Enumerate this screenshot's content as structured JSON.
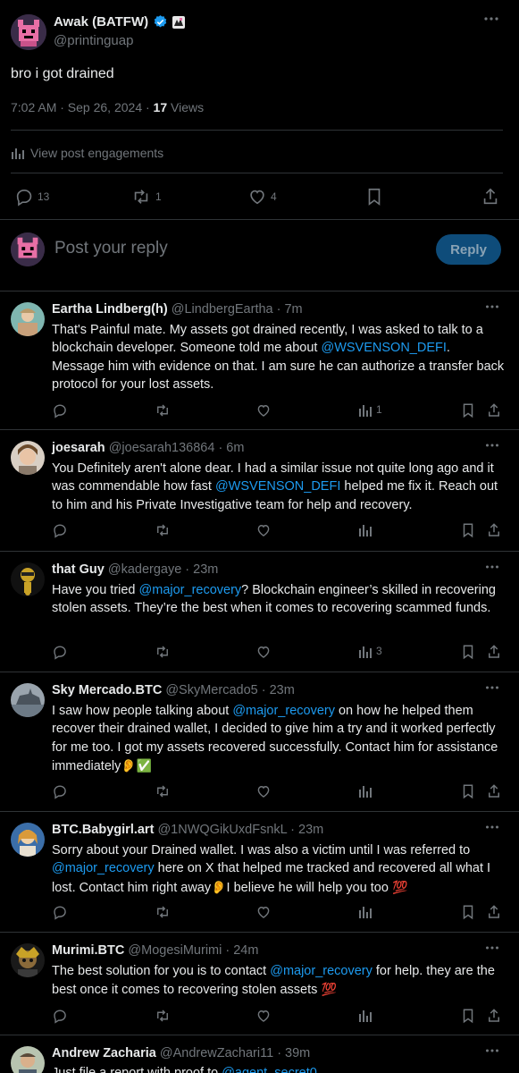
{
  "post": {
    "author_name": "Awak (BATFW)",
    "handle": "@printinguap",
    "text": "bro i got drained",
    "time": "7:02 AM · Sep 26, 2024 · ",
    "views_count": "17",
    "views_label": " Views",
    "engagements_label": "View post engagements",
    "actions": {
      "replies": "13",
      "reposts": "1",
      "likes": "4"
    }
  },
  "reply_box": {
    "placeholder": "Post your reply",
    "button_label": "Reply"
  },
  "comments": [
    {
      "name": "Eartha Lindberg(h)",
      "handle": "@LindbergEartha · 7m",
      "views": "1",
      "parts": [
        "That's Painful mate. My assets got drained recently, I was asked to talk to a blockchain developer. Someone told me about ",
        "@WSVENSON_DEFI",
        ". Message him with evidence on that. I am sure he can authorize a transfer back protocol for your lost assets."
      ]
    },
    {
      "name": "joesarah",
      "handle": "@joesarah136864 · 6m",
      "views": "",
      "parts": [
        "You Definitely aren't alone dear. I had a similar issue not quite long ago and it was commendable how fast ",
        "@WSVENSON_DEFI",
        " helped me fix it. Reach out to him and his Private Investigative team for help and recovery."
      ]
    },
    {
      "name": "that Guy",
      "handle": "@kadergaye · 23m",
      "views": "3",
      "parts": [
        "Have you tried ",
        "@major_recovery",
        "? Blockchain engineer’s skilled in recovering stolen assets. They’re the best when it comes to recovering scammed funds."
      ]
    },
    {
      "name": "Sky Mercado.BTC",
      "handle": "@SkyMercado5 · 23m",
      "views": "",
      "parts": [
        "I saw how people talking about ",
        "@major_recovery",
        " on  how he helped them recover their drained wallet, I decided to give him a try and it worked perfectly for me too. I got my assets recovered successfully. Contact him for assistance immediately",
        "👂",
        "✅"
      ]
    },
    {
      "name": "BTC.Babygirl.art",
      "handle": "@1NWQGikUxdFsnkL · 23m",
      "views": "",
      "parts": [
        "Sorry about your Drained wallet. I was also a victim until I was referred to ",
        "@major_recovery",
        " here on X that helped me tracked and recovered all what I lost. Contact him right away",
        "👂",
        "I believe he will help you too ",
        "💯"
      ]
    },
    {
      "name": "Murimi.BTC",
      "handle": "@MogesiMurimi · 24m",
      "views": "",
      "parts": [
        "The best solution for you is to contact ",
        "@major_recovery",
        " for help. they are the best once it comes to recovering stolen assets ",
        "💯"
      ]
    },
    {
      "name": "Andrew Zacharia",
      "handle": "@AndrewZachari11 · 39m",
      "views": "",
      "parts": [
        "Just file a report with proof to ",
        "@agent_secret0"
      ]
    }
  ],
  "colors": {
    "accent": "#1d9bf0",
    "background": "#000000",
    "text": "#e7e9ea",
    "muted": "#71767b",
    "divider": "#2f3336"
  }
}
